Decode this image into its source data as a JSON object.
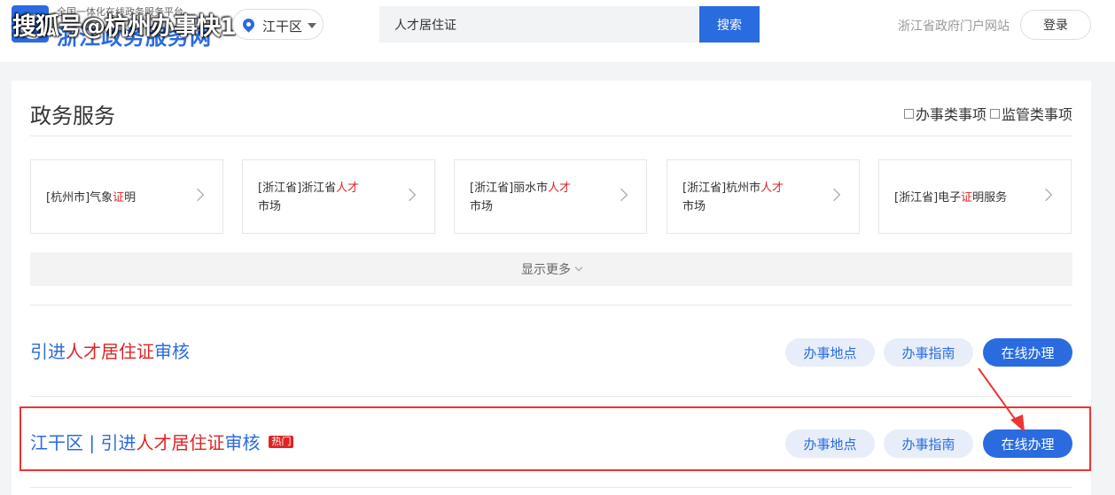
{
  "header": {
    "watermark": "搜狐号@杭州办事快1",
    "slogan": "全国一体化在线政务服务平台",
    "site_name": "浙江政务服务网",
    "region": "江干区",
    "search_value": "人才居住证",
    "search_button": "搜索",
    "portal_link": "浙江省政府门户网站",
    "login_button": "登录"
  },
  "section": {
    "title": "政务服务",
    "filters": [
      "办事类事项",
      "监管类事项"
    ]
  },
  "tiles": [
    {
      "pre": "[杭州市]气象",
      "hl": "证",
      "post": "明"
    },
    {
      "pre": "[浙江省]浙江省",
      "hl": "人才",
      "post": "市场"
    },
    {
      "pre": "[浙江省]丽水市",
      "hl": "人才",
      "post": "市场"
    },
    {
      "pre": "[浙江省]杭州市",
      "hl": "人才",
      "post": "市场"
    },
    {
      "pre": "[浙江省]电子",
      "hl": "证",
      "post": "明服务"
    }
  ],
  "show_more": "显示更多",
  "items": [
    {
      "title_pre": "引进",
      "title_hl": "人才居住证",
      "title_post": "审核",
      "badge": "",
      "buttons": [
        "办事地点",
        "办事指南",
        "在线办理"
      ]
    },
    {
      "title_pre": "江干区 | 引进",
      "title_hl": "人才居住证",
      "title_post": "审核",
      "badge": "热门",
      "buttons": [
        "办事地点",
        "办事指南",
        "在线办理"
      ]
    }
  ],
  "colors": {
    "brand": "#2a6be0",
    "highlight": "#e02424",
    "annotation": "#e33333"
  }
}
